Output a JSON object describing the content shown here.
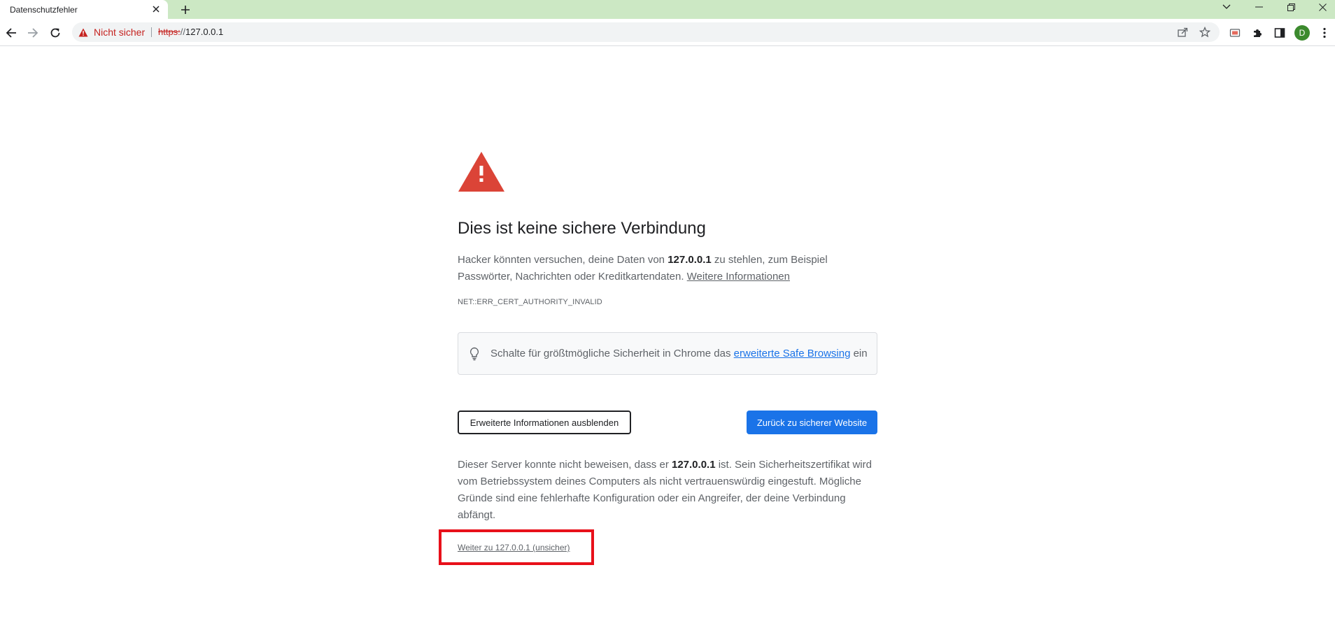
{
  "browser": {
    "tab_title": "Datenschutzfehler",
    "address_bar": {
      "security_label": "Nicht sicher",
      "url_scheme": "https:",
      "url_rest": "//",
      "url_host": "127.0.0.1"
    },
    "profile_initial": "D",
    "colors": {
      "tabstrip": "#cce8c4",
      "not_secure": "#c5221f",
      "accent": "#1a73e8"
    }
  },
  "interstitial": {
    "heading": "Dies ist keine sichere Verbindung",
    "intro_pre": "Hacker könnten versuchen, deine Daten von ",
    "intro_host": "127.0.0.1",
    "intro_post": " zu stehlen, zum Beispiel Passwörter, Nachrichten oder Kreditkartendaten. ",
    "learn_more": "Weitere Informationen",
    "error_code": "NET::ERR_CERT_AUTHORITY_INVALID",
    "safe_browsing_pre": "Schalte für größtmögliche Sicherheit in Chrome das ",
    "safe_browsing_link": "erweiterte Safe Browsing",
    "safe_browsing_post": " ein",
    "details_button": "Erweiterte Informationen ausblenden",
    "back_button": "Zurück zu sicherer Website",
    "details_pre": "Dieser Server konnte nicht beweisen, dass er ",
    "details_host": "127.0.0.1",
    "details_post": " ist. Sein Sicherheitszertifikat wird vom Betriebssystem deines Computers als nicht vertrauenswürdig eingestuft. Mögliche Gründe sind eine fehlerhafte Konfiguration oder ein Angreifer, der deine Verbindung abfängt.",
    "proceed_link": "Weiter zu 127.0.0.1 (unsicher)",
    "highlight_color": "#e8101a"
  },
  "icons": [
    "warning-triangle-icon",
    "close-icon",
    "plus-icon",
    "chevron-down-icon",
    "minimize-icon",
    "restore-icon",
    "back-arrow-icon",
    "forward-arrow-icon",
    "reload-icon",
    "share-icon",
    "star-icon",
    "cast-icon",
    "extensions-puzzle-icon",
    "side-panel-icon",
    "more-vert-icon",
    "lightbulb-icon"
  ]
}
